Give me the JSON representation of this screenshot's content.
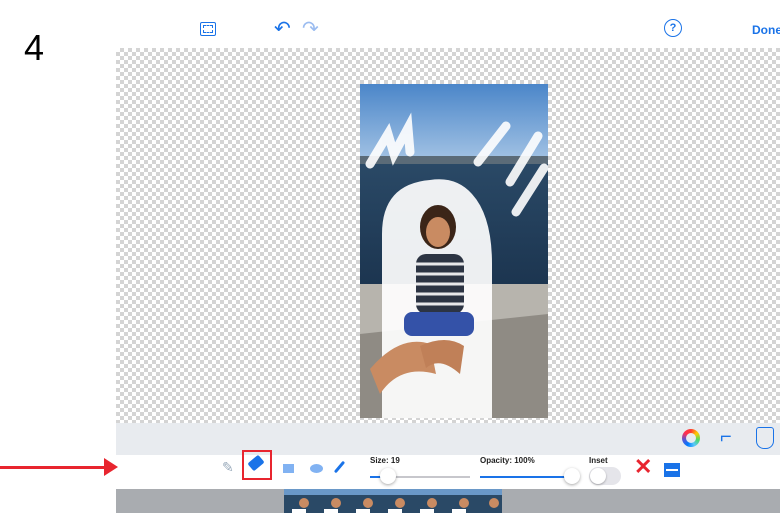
{
  "step": {
    "number": "4"
  },
  "toolbar": {
    "fullscreen_icon": "fullscreen-icon",
    "undo_icon": "undo-icon",
    "redo_icon": "redo-icon",
    "help_label": "?",
    "done_label": "Done"
  },
  "tools": {
    "items": [
      "pencil-icon",
      "eraser-icon",
      "rectangle-icon",
      "ellipse-icon",
      "brush-icon"
    ],
    "selected": "eraser-icon"
  },
  "size": {
    "label": "Size: 19",
    "value": 19,
    "fraction": 0.18
  },
  "opacity": {
    "label": "Opacity: 100%",
    "value": 100,
    "fraction": 1.0
  },
  "inset": {
    "label": "Inset",
    "on": false
  },
  "actions": {
    "delete_label": "✕"
  },
  "colors": {
    "accent": "#1a73e8",
    "highlight": "#e8252f"
  }
}
